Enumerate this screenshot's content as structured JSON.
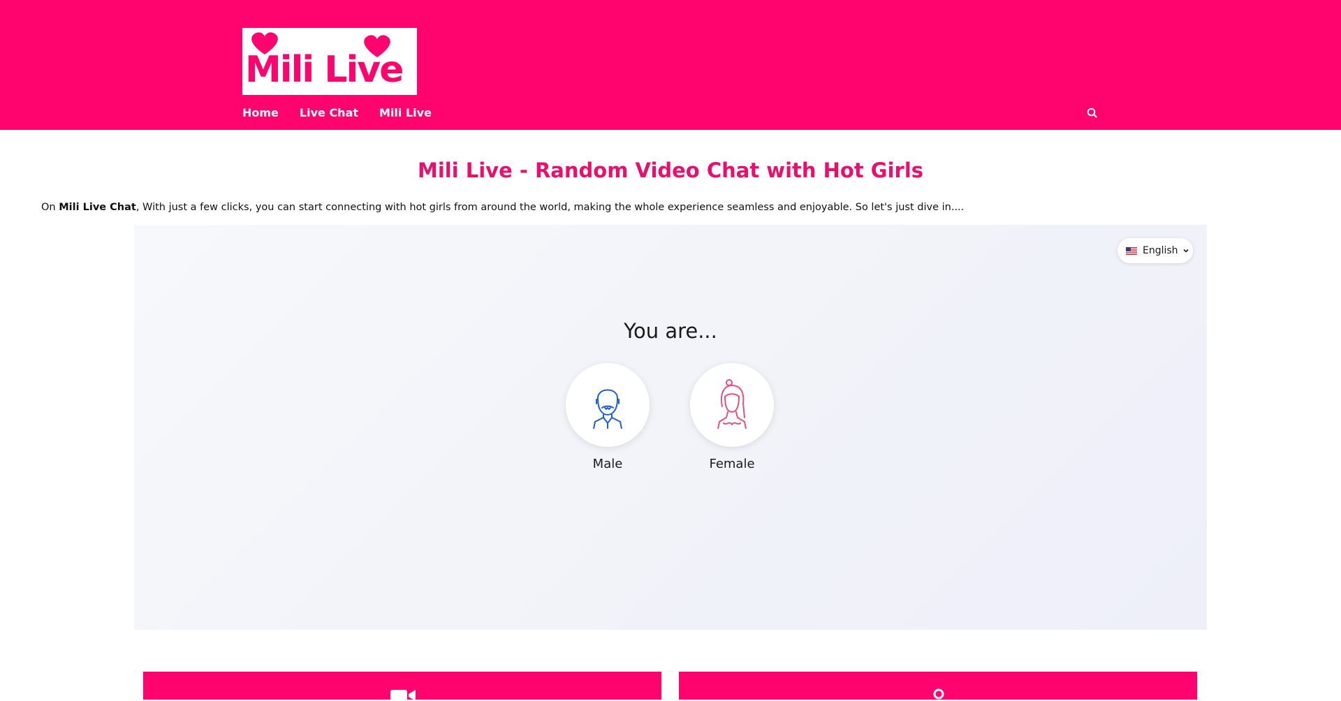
{
  "header": {
    "logo_text": "Mili Live",
    "nav": [
      "Home",
      "Live Chat",
      "Mili Live"
    ]
  },
  "main": {
    "title": "Mili Live - Random Video Chat with Hot Girls",
    "intro_prefix": "On ",
    "intro_bold": "Mili Live Chat",
    "intro_rest": ", With just a few clicks, you can start connecting with hot girls from around the world, making the whole experience seamless and enjoyable. So let's just dive in...."
  },
  "chat": {
    "language": "English",
    "prompt": "You are...",
    "options": [
      "Male",
      "Female"
    ]
  },
  "colors": {
    "brand": "#ff036f",
    "title": "#e8106d",
    "male_icon": "#1f5fd1",
    "female_icon": "#e6507e"
  },
  "icons": {
    "search": "search-icon",
    "language_flag": "us-flag-icon",
    "dropdown": "chevron-down-icon",
    "male": "male-avatar-icon",
    "female": "female-avatar-icon",
    "video": "video-camera-icon",
    "location": "location-pin-icon"
  }
}
